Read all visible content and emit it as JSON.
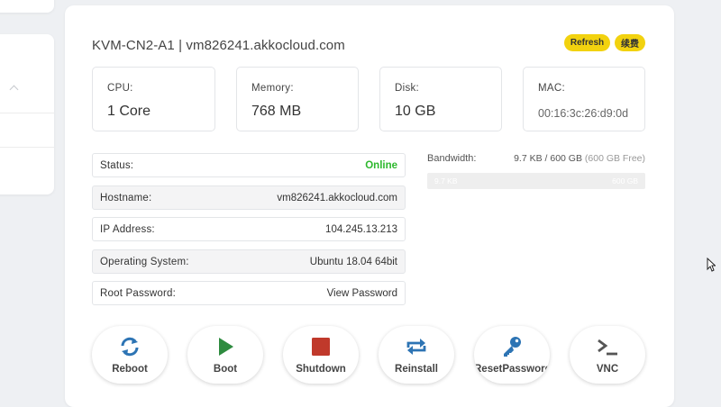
{
  "server": {
    "title": "KVM-CN2-A1 | vm826241.akkocloud.com",
    "refresh_label": "Refresh",
    "renew_label": "续费"
  },
  "specs": [
    {
      "label": "CPU:",
      "value": "1 Core"
    },
    {
      "label": "Memory:",
      "value": "768 MB"
    },
    {
      "label": "Disk:",
      "value": "10 GB"
    },
    {
      "label": "MAC:",
      "value": "00:16:3c:26:d9:0d"
    }
  ],
  "info": {
    "status": {
      "label": "Status:",
      "value": "Online"
    },
    "hostname": {
      "label": "Hostname:",
      "value": "vm826241.akkocloud.com"
    },
    "ip": {
      "label": "IP Address:",
      "value": "104.245.13.213"
    },
    "os": {
      "label": "Operating System:",
      "value": "Ubuntu 18.04 64bit"
    },
    "root_password": {
      "label": "Root Password:",
      "value": "View Password"
    }
  },
  "bandwidth": {
    "label": "Bandwidth:",
    "usage": "9.7 KB / 600 GB",
    "free": "(600 GB Free)",
    "bar_left": "9.7 KB",
    "bar_right": "600 GB"
  },
  "actions": {
    "reboot": "Reboot",
    "boot": "Boot",
    "shutdown": "Shutdown",
    "reinstall": "Reinstall",
    "reset_password": "ResetPassword",
    "vnc": "VNC"
  },
  "colors": {
    "accent_yellow": "#f2d20f",
    "online_green": "#2eb82e",
    "icon_blue": "#2d74b4",
    "boot_green": "#2e8b3f",
    "shutdown_red": "#c0392b",
    "vnc_gray": "#555555"
  },
  "icons": [
    "refresh-icon",
    "play-icon",
    "stop-icon",
    "reinstall-icon",
    "key-icon",
    "terminal-icon",
    "chevron-up-icon",
    "mouse-cursor-icon"
  ]
}
